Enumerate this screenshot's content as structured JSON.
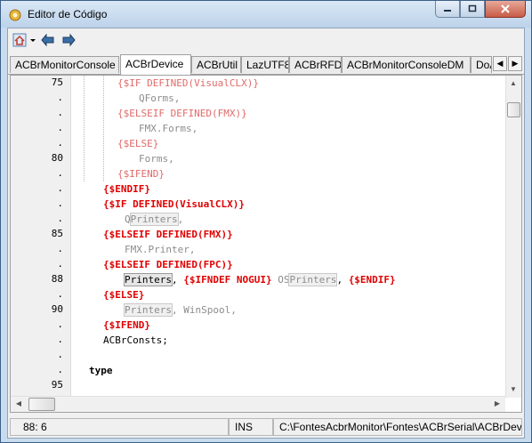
{
  "window": {
    "title": "Editor de Código"
  },
  "tabs": [
    "ACBrMonitorConsole",
    "ACBrDevice",
    "ACBrUtil",
    "LazUTF8",
    "ACBrRFD",
    "ACBrMonitorConsoleDM",
    "DoA"
  ],
  "gutter": [
    "75",
    ".",
    ".",
    ".",
    ".",
    "80",
    ".",
    ".",
    ".",
    ".",
    "85",
    ".",
    ".",
    "88",
    ".",
    "90",
    ".",
    ".",
    ".",
    ".",
    "95"
  ],
  "code": {
    "l1": "{$IF DEFINED(VisualCLX)}",
    "l2": "QForms,",
    "l3": "{$ELSEIF DEFINED(FMX)}",
    "l4": "FMX.Forms,",
    "l5": "{$ELSE}",
    "l6": "Forms,",
    "l7": "{$IFEND}",
    "l8": "{$ENDIF}",
    "l9": "{$IF DEFINED(VisualCLX)}",
    "l10a": "Q",
    "l10b": "Printers",
    "l10c": ",",
    "l11": "{$ELSEIF DEFINED(FMX)}",
    "l12": "FMX.Printer,",
    "l13": "{$ELSEIF DEFINED(FPC)}",
    "l14a": "Printers",
    "l14b": ", ",
    "l14c": "{$IFNDEF NOGUI}",
    "l14d": " OS",
    "l14e": "Printers",
    "l14f": ", ",
    "l14g": "{$ENDIF}",
    "l15": "{$ELSE}",
    "l16a": "Printers",
    "l16b": ", WinSpool,",
    "l17": "{$IFEND}",
    "l18": "ACBrConsts;",
    "l20": "type"
  },
  "status": {
    "position": "88:  6",
    "mode": "INS",
    "path": "C:\\FontesAcbrMonitor\\Fontes\\ACBrSerial\\ACBrDevice.pas"
  }
}
